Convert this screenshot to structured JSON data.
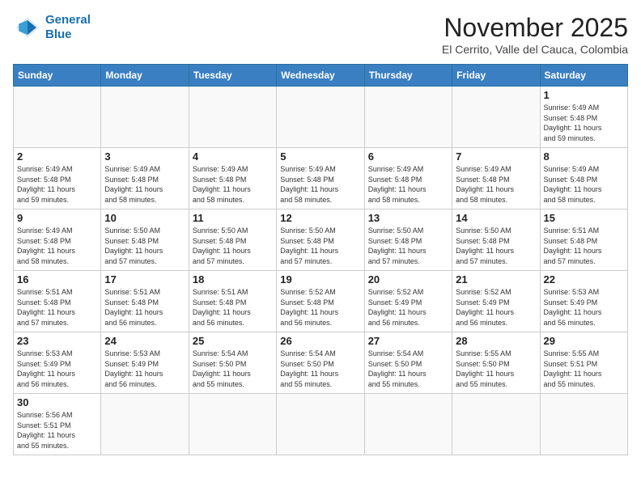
{
  "header": {
    "logo_line1": "General",
    "logo_line2": "Blue",
    "month": "November 2025",
    "location": "El Cerrito, Valle del Cauca, Colombia"
  },
  "weekdays": [
    "Sunday",
    "Monday",
    "Tuesday",
    "Wednesday",
    "Thursday",
    "Friday",
    "Saturday"
  ],
  "weeks": [
    [
      {
        "day": "",
        "info": ""
      },
      {
        "day": "",
        "info": ""
      },
      {
        "day": "",
        "info": ""
      },
      {
        "day": "",
        "info": ""
      },
      {
        "day": "",
        "info": ""
      },
      {
        "day": "",
        "info": ""
      },
      {
        "day": "1",
        "info": "Sunrise: 5:49 AM\nSunset: 5:48 PM\nDaylight: 11 hours\nand 59 minutes."
      }
    ],
    [
      {
        "day": "2",
        "info": "Sunrise: 5:49 AM\nSunset: 5:48 PM\nDaylight: 11 hours\nand 59 minutes."
      },
      {
        "day": "3",
        "info": "Sunrise: 5:49 AM\nSunset: 5:48 PM\nDaylight: 11 hours\nand 58 minutes."
      },
      {
        "day": "4",
        "info": "Sunrise: 5:49 AM\nSunset: 5:48 PM\nDaylight: 11 hours\nand 58 minutes."
      },
      {
        "day": "5",
        "info": "Sunrise: 5:49 AM\nSunset: 5:48 PM\nDaylight: 11 hours\nand 58 minutes."
      },
      {
        "day": "6",
        "info": "Sunrise: 5:49 AM\nSunset: 5:48 PM\nDaylight: 11 hours\nand 58 minutes."
      },
      {
        "day": "7",
        "info": "Sunrise: 5:49 AM\nSunset: 5:48 PM\nDaylight: 11 hours\nand 58 minutes."
      },
      {
        "day": "8",
        "info": "Sunrise: 5:49 AM\nSunset: 5:48 PM\nDaylight: 11 hours\nand 58 minutes."
      }
    ],
    [
      {
        "day": "9",
        "info": "Sunrise: 5:49 AM\nSunset: 5:48 PM\nDaylight: 11 hours\nand 58 minutes."
      },
      {
        "day": "10",
        "info": "Sunrise: 5:50 AM\nSunset: 5:48 PM\nDaylight: 11 hours\nand 57 minutes."
      },
      {
        "day": "11",
        "info": "Sunrise: 5:50 AM\nSunset: 5:48 PM\nDaylight: 11 hours\nand 57 minutes."
      },
      {
        "day": "12",
        "info": "Sunrise: 5:50 AM\nSunset: 5:48 PM\nDaylight: 11 hours\nand 57 minutes."
      },
      {
        "day": "13",
        "info": "Sunrise: 5:50 AM\nSunset: 5:48 PM\nDaylight: 11 hours\nand 57 minutes."
      },
      {
        "day": "14",
        "info": "Sunrise: 5:50 AM\nSunset: 5:48 PM\nDaylight: 11 hours\nand 57 minutes."
      },
      {
        "day": "15",
        "info": "Sunrise: 5:51 AM\nSunset: 5:48 PM\nDaylight: 11 hours\nand 57 minutes."
      }
    ],
    [
      {
        "day": "16",
        "info": "Sunrise: 5:51 AM\nSunset: 5:48 PM\nDaylight: 11 hours\nand 57 minutes."
      },
      {
        "day": "17",
        "info": "Sunrise: 5:51 AM\nSunset: 5:48 PM\nDaylight: 11 hours\nand 56 minutes."
      },
      {
        "day": "18",
        "info": "Sunrise: 5:51 AM\nSunset: 5:48 PM\nDaylight: 11 hours\nand 56 minutes."
      },
      {
        "day": "19",
        "info": "Sunrise: 5:52 AM\nSunset: 5:48 PM\nDaylight: 11 hours\nand 56 minutes."
      },
      {
        "day": "20",
        "info": "Sunrise: 5:52 AM\nSunset: 5:49 PM\nDaylight: 11 hours\nand 56 minutes."
      },
      {
        "day": "21",
        "info": "Sunrise: 5:52 AM\nSunset: 5:49 PM\nDaylight: 11 hours\nand 56 minutes."
      },
      {
        "day": "22",
        "info": "Sunrise: 5:53 AM\nSunset: 5:49 PM\nDaylight: 11 hours\nand 56 minutes."
      }
    ],
    [
      {
        "day": "23",
        "info": "Sunrise: 5:53 AM\nSunset: 5:49 PM\nDaylight: 11 hours\nand 56 minutes."
      },
      {
        "day": "24",
        "info": "Sunrise: 5:53 AM\nSunset: 5:49 PM\nDaylight: 11 hours\nand 56 minutes."
      },
      {
        "day": "25",
        "info": "Sunrise: 5:54 AM\nSunset: 5:50 PM\nDaylight: 11 hours\nand 55 minutes."
      },
      {
        "day": "26",
        "info": "Sunrise: 5:54 AM\nSunset: 5:50 PM\nDaylight: 11 hours\nand 55 minutes."
      },
      {
        "day": "27",
        "info": "Sunrise: 5:54 AM\nSunset: 5:50 PM\nDaylight: 11 hours\nand 55 minutes."
      },
      {
        "day": "28",
        "info": "Sunrise: 5:55 AM\nSunset: 5:50 PM\nDaylight: 11 hours\nand 55 minutes."
      },
      {
        "day": "29",
        "info": "Sunrise: 5:55 AM\nSunset: 5:51 PM\nDaylight: 11 hours\nand 55 minutes."
      }
    ],
    [
      {
        "day": "30",
        "info": "Sunrise: 5:56 AM\nSunset: 5:51 PM\nDaylight: 11 hours\nand 55 minutes."
      },
      {
        "day": "",
        "info": ""
      },
      {
        "day": "",
        "info": ""
      },
      {
        "day": "",
        "info": ""
      },
      {
        "day": "",
        "info": ""
      },
      {
        "day": "",
        "info": ""
      },
      {
        "day": "",
        "info": ""
      }
    ]
  ]
}
